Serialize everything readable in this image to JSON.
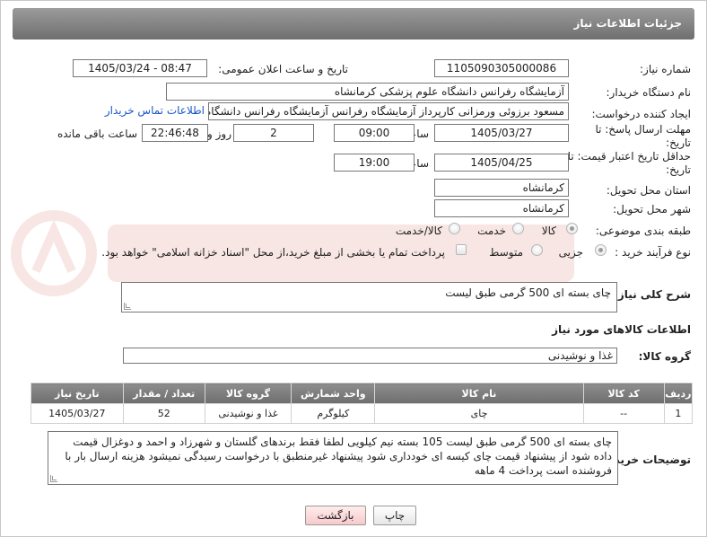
{
  "header": {
    "title": "جزئیات اطلاعات نیاز"
  },
  "fields": {
    "need_number_label": "شماره نیاز:",
    "need_number": "1105090305000086",
    "announce_label": "تاریخ و ساعت اعلان عمومی:",
    "announce_value": "1405/03/24 - 08:47",
    "buyer_org_label": "نام دستگاه خریدار:",
    "buyer_org": "آزمایشگاه رفرانس دانشگاه علوم پزشکی کرمانشاه",
    "creator_label": "ایجاد کننده درخواست:",
    "creator": "مسعود برزوئی ورمزانی کارپرداز آزمایشگاه رفرانس آزمایشگاه رفرانس دانشگاه ع",
    "contact_link": "اطلاعات تماس خریدار",
    "deadline_label": "مهلت ارسال پاسخ: تا تاریخ:",
    "deadline_date": "1405/03/27",
    "time_label": "ساعت",
    "deadline_time": "09:00",
    "days_value": "2",
    "days_label": "روز و",
    "remaining_time": "22:46:48",
    "remaining_label": "ساعت باقی مانده",
    "validity_label": "حداقل تاریخ اعتبار قیمت: تا تاریخ:",
    "validity_date": "1405/04/25",
    "validity_time": "19:00",
    "province_label": "استان محل تحویل:",
    "province": "کرمانشاه",
    "city_label": "شهر محل تحویل:",
    "city": "کرمانشاه",
    "category_label": "طبقه بندی موضوعی:",
    "category_options": [
      "کالا",
      "خدمت",
      "کالا/خدمت"
    ],
    "purchase_type_label": "نوع فرآیند خرید :",
    "purchase_options": [
      "جزیی",
      "متوسط"
    ],
    "payment_note": "پرداخت تمام یا بخشی از مبلغ خرید،از محل \"اسناد خزانه اسلامی\" خواهد بود."
  },
  "summary": {
    "label": "شرح کلی نیاز:",
    "value": "چای بسته ای 500 گرمی طبق لیست"
  },
  "goods": {
    "section_title": "اطلاعات کالاهای مورد نیاز",
    "group_label": "گروه کالا:",
    "group_value": "غذا و نوشیدنی",
    "columns": [
      "ردیف",
      "کد کالا",
      "نام کالا",
      "واحد شمارش",
      "گروه کالا",
      "تعداد / مقدار",
      "تاریخ نیاز"
    ],
    "rows": [
      [
        "1",
        "--",
        "چای",
        "کیلوگرم",
        "غذا و نوشیدنی",
        "52",
        "1405/03/27"
      ]
    ]
  },
  "notes": {
    "label": "توضیحات خریدار:",
    "value": "چای بسته ای 500 گرمی طبق لیست 105 بسته نیم کیلویی لطفا فقط برندهای گلستان و شهرزاد و احمد و دوغزال قیمت داده شود از پیشنهاد قیمت چای کیسه ای خودداری شود پیشنهاد غیرمنطبق با درخواست رسیدگی نمیشود هزینه ارسال بار با فروشنده است پرداخت 4 ماهه"
  },
  "buttons": {
    "print": "چاپ",
    "back": "بازگشت"
  }
}
